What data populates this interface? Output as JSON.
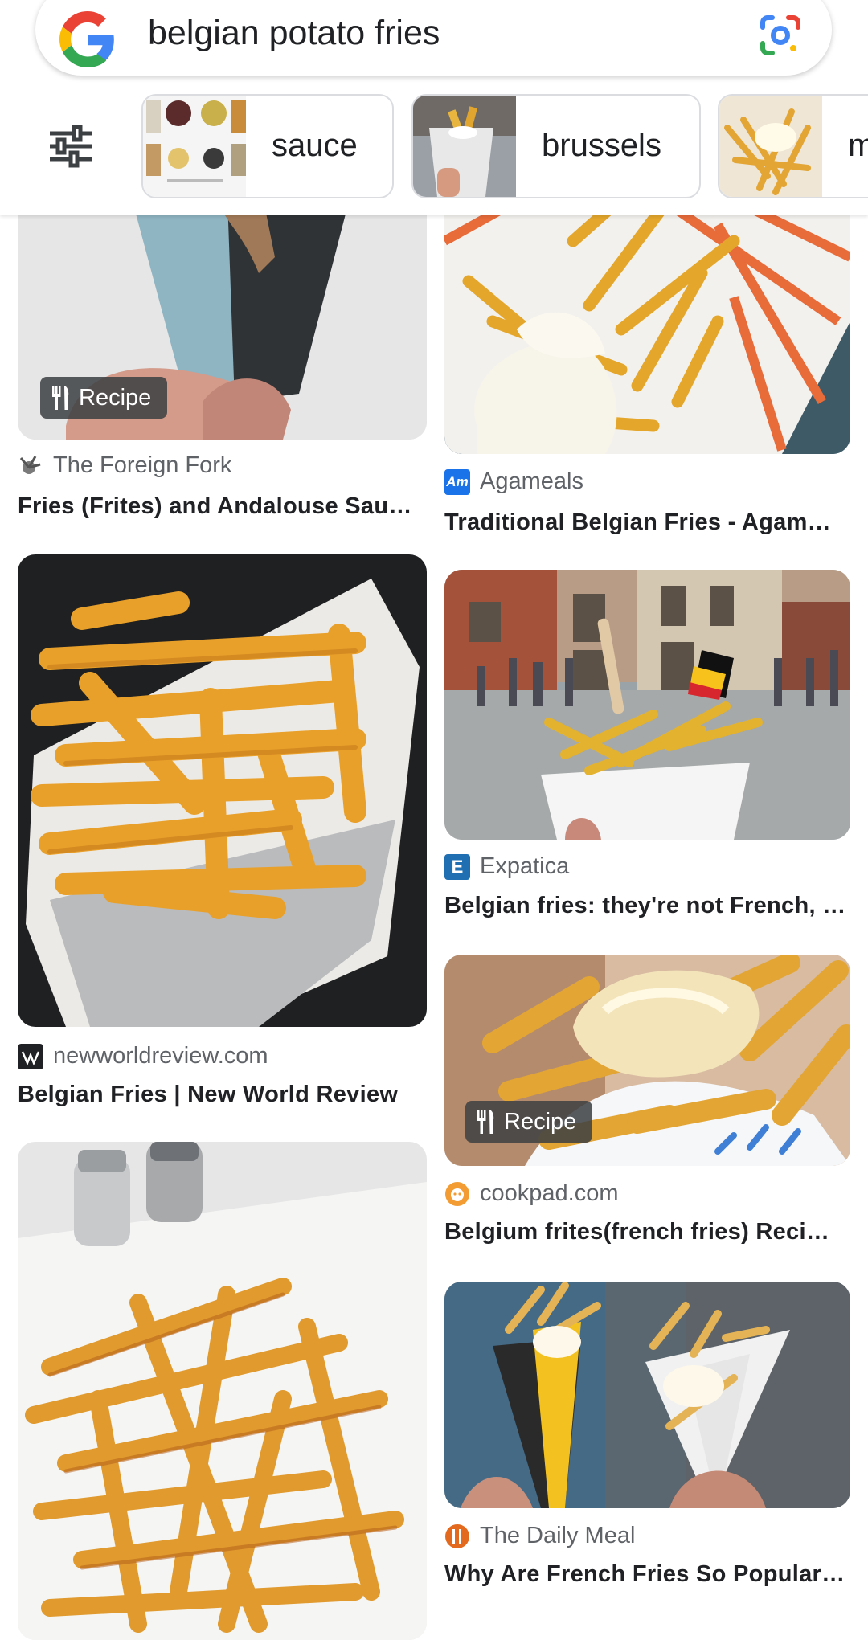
{
  "search": {
    "query": "belgian potato fries"
  },
  "chips": [
    {
      "label": "sauce"
    },
    {
      "label": "brussels"
    },
    {
      "label": "m"
    }
  ],
  "badges": {
    "recipe": "Recipe"
  },
  "results": [
    {
      "source": "The Foreign Fork",
      "title": "Fries (Frites) and Andalouse Sau…"
    },
    {
      "source": "Agameals",
      "title": "Traditional Belgian Fries - Agam…"
    },
    {
      "source": "newworldreview.com",
      "title": "Belgian Fries | New World Review"
    },
    {
      "source": "Expatica",
      "title": "Belgian fries: they're not French, …"
    },
    {
      "source": "cookpad.com",
      "title": "Belgium frites(french fries) Reci…"
    },
    {
      "source": "The Daily Meal",
      "title": "Why Are French Fries So Popular…"
    }
  ],
  "favicons": {
    "agameals": "Am",
    "expatica": "E"
  },
  "colors": {
    "google_blue": "#4285F4",
    "google_red": "#EA4335",
    "google_yellow": "#FBBC05",
    "google_green": "#34A853"
  }
}
